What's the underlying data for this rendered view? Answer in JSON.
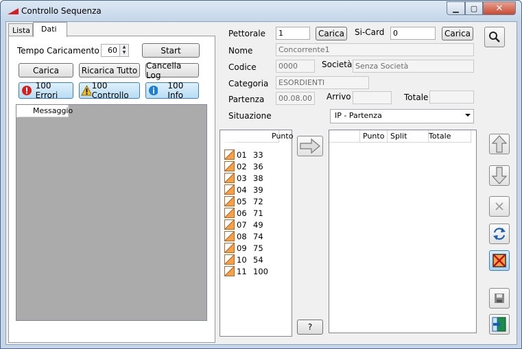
{
  "window": {
    "title": "Controllo Sequenza",
    "close_glyph": "✕",
    "min_glyph": "▁",
    "max_glyph": "▢"
  },
  "tabs": [
    {
      "label": "Lista"
    },
    {
      "label": "Dati"
    }
  ],
  "left": {
    "tempo_label": "Tempo Caricamento (s)",
    "tempo_value": "60",
    "start_label": "Start",
    "carica_label": "Carica",
    "ricarica_label": "Ricarica Tutto",
    "cancella_label": "Cancella Log",
    "errori_label": "100 Errori",
    "controllo_label": "100 Controllo",
    "info_label": "100 Info",
    "messaggio_header": "Messaggio"
  },
  "form": {
    "pettorale_label": "Pettorale",
    "pettorale_value": "1",
    "pettorale_btn": "Carica",
    "sicard_label": "Si-Card",
    "sicard_value": "0",
    "sicard_btn": "Carica",
    "nome_label": "Nome",
    "nome_value": "Concorrente1",
    "codice_label": "Codice",
    "codice_value": "0000",
    "societa_label": "Società",
    "societa_value": "Senza Società",
    "categoria_label": "Categoria",
    "categoria_value": "ESORDIENTI",
    "partenza_label": "Partenza",
    "partenza_value": "00.08.00",
    "arrivo_label": "Arrivo",
    "arrivo_value": "",
    "totale_label": "Totale",
    "totale_value": "",
    "situazione_label": "Situazione",
    "situazione_value": "IP - Partenza"
  },
  "punti": {
    "header": "Punto",
    "rows": [
      {
        "num": "01",
        "punto": "33"
      },
      {
        "num": "02",
        "punto": "36"
      },
      {
        "num": "03",
        "punto": "38"
      },
      {
        "num": "04",
        "punto": "39"
      },
      {
        "num": "05",
        "punto": "72"
      },
      {
        "num": "06",
        "punto": "71"
      },
      {
        "num": "07",
        "punto": "49"
      },
      {
        "num": "08",
        "punto": "74"
      },
      {
        "num": "09",
        "punto": "75"
      },
      {
        "num": "10",
        "punto": "54"
      },
      {
        "num": "11",
        "punto": "100"
      }
    ]
  },
  "splits": {
    "headers": [
      "Punto",
      "Split",
      "Totale"
    ],
    "rows": []
  },
  "help_label": "?",
  "icons": {
    "search": "search-icon",
    "arrow_right": "arrow-right-icon",
    "arrow_up": "arrow-up-icon",
    "arrow_down": "arrow-down-icon",
    "delete": "delete-icon",
    "refresh": "refresh-icon",
    "no_image": "no-image-icon",
    "save": "save-icon",
    "exit": "exit-icon"
  },
  "colors": {
    "error": "#d62020",
    "warning": "#f0c020",
    "info": "#1b7fd6",
    "accent": "#f7a145"
  }
}
